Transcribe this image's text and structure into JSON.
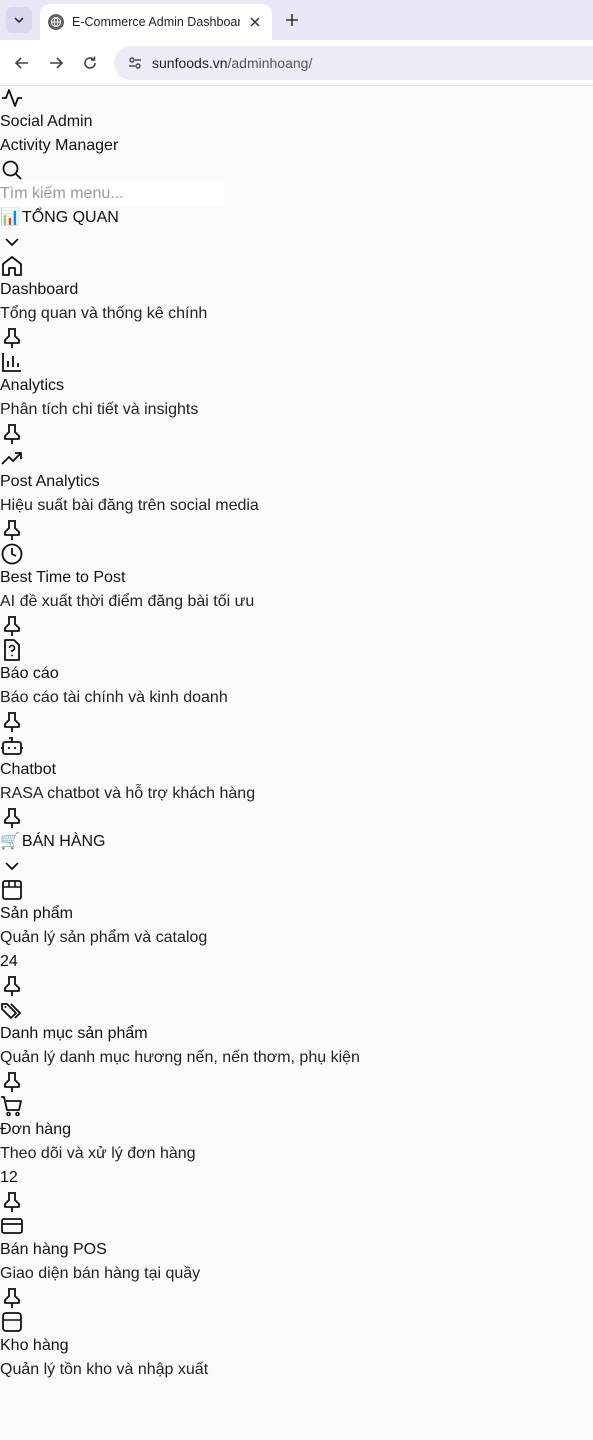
{
  "browser": {
    "tab_title": "E-Commerce Admin Dashboard",
    "url_host": "sunfoods.vn",
    "url_path": "/adminhoang/"
  },
  "brand": {
    "title": "Social Admin",
    "subtitle": "Activity Manager"
  },
  "search": {
    "placeholder": "Tìm kiếm menu..."
  },
  "sections": {
    "overview": {
      "emoji": "📊",
      "label": "TỔNG QUAN",
      "items": [
        {
          "title": "Dashboard",
          "desc": "Tổng quan và thống kê chính",
          "icon": "home-icon"
        },
        {
          "title": "Analytics",
          "desc": "Phân tích chi tiết và insights",
          "icon": "bar-chart-icon"
        },
        {
          "title": "Post Analytics",
          "desc": "Hiệu suất bài đăng trên social media",
          "icon": "trending-up-icon"
        },
        {
          "title": "Best Time to Post",
          "desc": "AI đề xuất thời điểm đăng bài tối ưu",
          "icon": "clock-icon"
        },
        {
          "title": "Báo cáo",
          "desc": "Báo cáo tài chính và kinh doanh",
          "icon": "file-question-icon"
        },
        {
          "title": "Chatbot",
          "desc": "RASA chatbot và hỗ trợ khách hàng",
          "icon": "bot-icon"
        }
      ]
    },
    "sales": {
      "emoji": "🛒",
      "label": "BÁN HÀNG",
      "items": [
        {
          "title": "Sản phẩm",
          "desc": "Quản lý sản phẩm và catalog",
          "badge": "24",
          "icon": "package-icon"
        },
        {
          "title": "Danh mục sản phẩm",
          "desc": "Quản lý danh mục hương nến, nến thơm, phụ kiện",
          "icon": "tags-icon"
        },
        {
          "title": "Đơn hàng",
          "desc": "Theo dõi và xử lý đơn hàng",
          "badge": "12",
          "icon": "cart-icon"
        },
        {
          "title": "Bán hàng POS",
          "desc": "Giao diện bán hàng tại quầy",
          "icon": "credit-card-icon"
        },
        {
          "title": "Kho hàng",
          "desc": "Quản lý tồn kho và nhập xuất",
          "icon": "warehouse-box-icon"
        }
      ]
    }
  }
}
